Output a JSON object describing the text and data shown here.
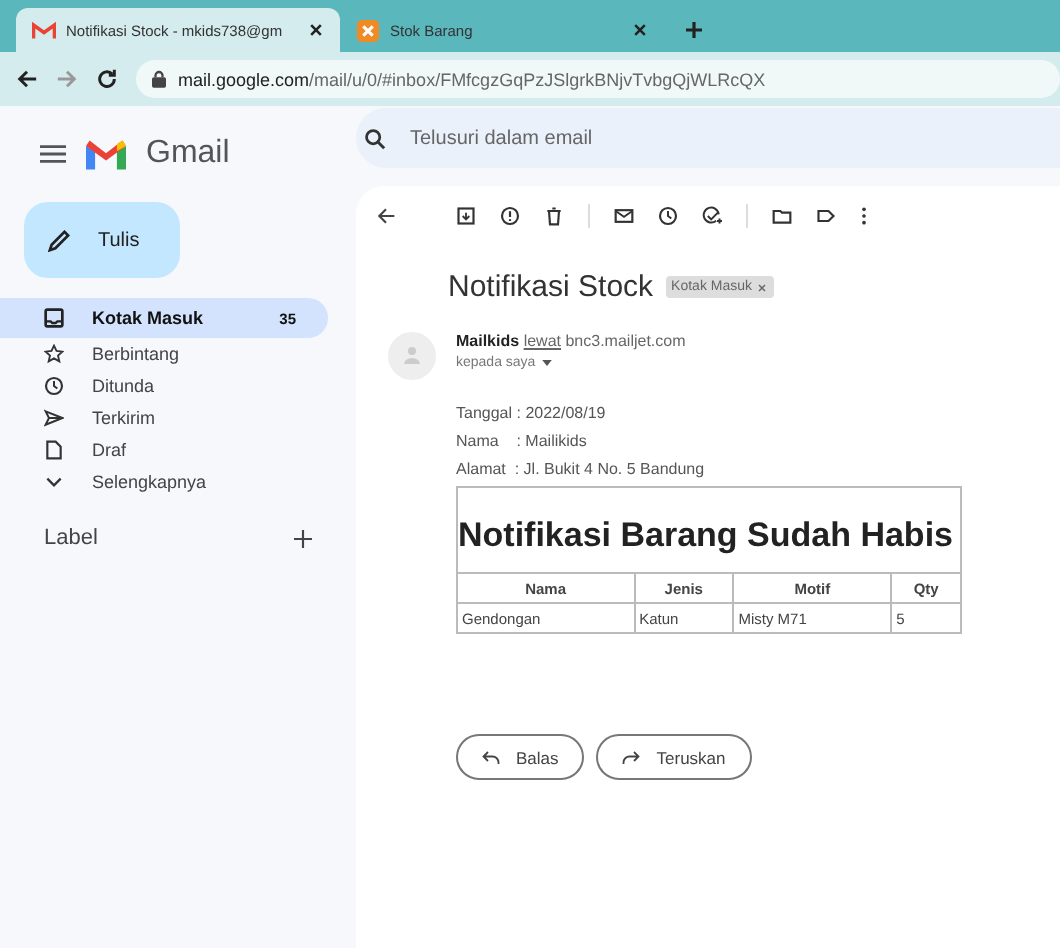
{
  "browser": {
    "tabs": [
      {
        "title": "Notifikasi Stock - mkids738@gm",
        "selected": true,
        "kind": "gmail"
      },
      {
        "title": "Stok Barang",
        "selected": false,
        "kind": "app"
      }
    ],
    "url_host": "mail.google.com",
    "url_path": "/mail/u/0/#inbox/FMfcgzGqPzJSlgrkBNjvTvbgQjWLRcQX"
  },
  "app": {
    "name": "Gmail",
    "search_placeholder": "Telusuri dalam email",
    "compose": "Tulis"
  },
  "sidebar": {
    "items": [
      {
        "label": "Kotak Masuk",
        "count": "35",
        "selected": true,
        "kind": "inbox"
      },
      {
        "label": "Berbintang",
        "selected": false,
        "kind": "star"
      },
      {
        "label": "Ditunda",
        "selected": false,
        "kind": "clock"
      },
      {
        "label": "Terkirim",
        "selected": false,
        "kind": "send"
      },
      {
        "label": "Draf",
        "selected": false,
        "kind": "draft"
      },
      {
        "label": "Selengkapnya",
        "selected": false,
        "kind": "more"
      }
    ],
    "labels_heading": "Label"
  },
  "email": {
    "subject": "Notifikasi Stock",
    "label_chip": "Kotak Masuk",
    "sender": "Mailkids",
    "via": "lewat",
    "via_domain": "bnc3.mailjet.com",
    "recipient": "kepada saya",
    "lines": [
      "Tanggal : 2022/08/19",
      "Nama    : Mailikids",
      "Alamat  : Jl. Bukit 4 No. 5 Bandung"
    ],
    "table": {
      "title": "Notifikasi Barang Sudah Habis",
      "columns": [
        "Nama",
        "Jenis",
        "Motif",
        "Qty"
      ],
      "rows": [
        [
          "Gendongan",
          "Katun",
          "Misty M71",
          "5"
        ]
      ]
    },
    "actions": [
      {
        "label": "Balas",
        "kind": "reply"
      },
      {
        "label": "Teruskan",
        "kind": "forward"
      }
    ]
  }
}
